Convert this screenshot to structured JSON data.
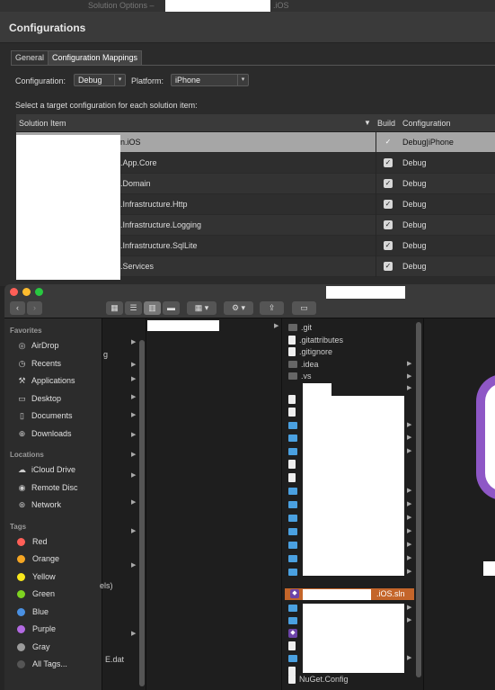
{
  "solution_options": {
    "title": "Solution Options –",
    "title_suffix": ".iOS",
    "heading": "Configurations",
    "tabs": [
      "General",
      "Configuration Mappings"
    ],
    "configuration_label": "Configuration:",
    "configuration_value": "Debug",
    "platform_label": "Platform:",
    "platform_value": "iPhone",
    "instruction": "Select a target configuration for each solution item:",
    "columns": [
      "Solution Item",
      "Build",
      "Configuration"
    ],
    "rows": [
      {
        "name": "n.iOS",
        "config": "Debug|iPhone",
        "build": "✓"
      },
      {
        "name": ".App.Core",
        "config": "Debug",
        "build": "✓"
      },
      {
        "name": ".Domain",
        "config": "Debug",
        "build": "✓"
      },
      {
        "name": ".Infrastructure.Http",
        "config": "Debug",
        "build": "✓"
      },
      {
        "name": ".Infrastructure.Logging",
        "config": "Debug",
        "build": "✓"
      },
      {
        "name": ".Infrastructure.SqlLite",
        "config": "Debug",
        "build": "✓"
      },
      {
        "name": ".Services",
        "config": "Debug",
        "build": "✓"
      }
    ]
  },
  "finder": {
    "sidebar": {
      "favorites_label": "Favorites",
      "favorites": [
        "AirDrop",
        "Recents",
        "Applications",
        "Desktop",
        "Documents",
        "Downloads"
      ],
      "locations_label": "Locations",
      "locations": [
        "iCloud Drive",
        "Remote Disc",
        "Network"
      ],
      "tags_label": "Tags",
      "tags": [
        {
          "name": "Red",
          "color": "#ff5f57"
        },
        {
          "name": "Orange",
          "color": "#f5a623"
        },
        {
          "name": "Yellow",
          "color": "#f8e71c"
        },
        {
          "name": "Green",
          "color": "#7ed321"
        },
        {
          "name": "Blue",
          "color": "#4a90e2"
        },
        {
          "name": "Purple",
          "color": "#b36ae2"
        },
        {
          "name": "Gray",
          "color": "#9b9b9b"
        }
      ],
      "all_tags": "All Tags..."
    },
    "col1_fragments": [
      "g",
      "els)",
      "E.dat"
    ],
    "files": [
      ".git",
      ".gitattributes",
      ".gitignore",
      ".idea",
      ".vs"
    ],
    "selected_file_suffix": ".iOS.sln",
    "last_file": "NuGet.Config"
  }
}
